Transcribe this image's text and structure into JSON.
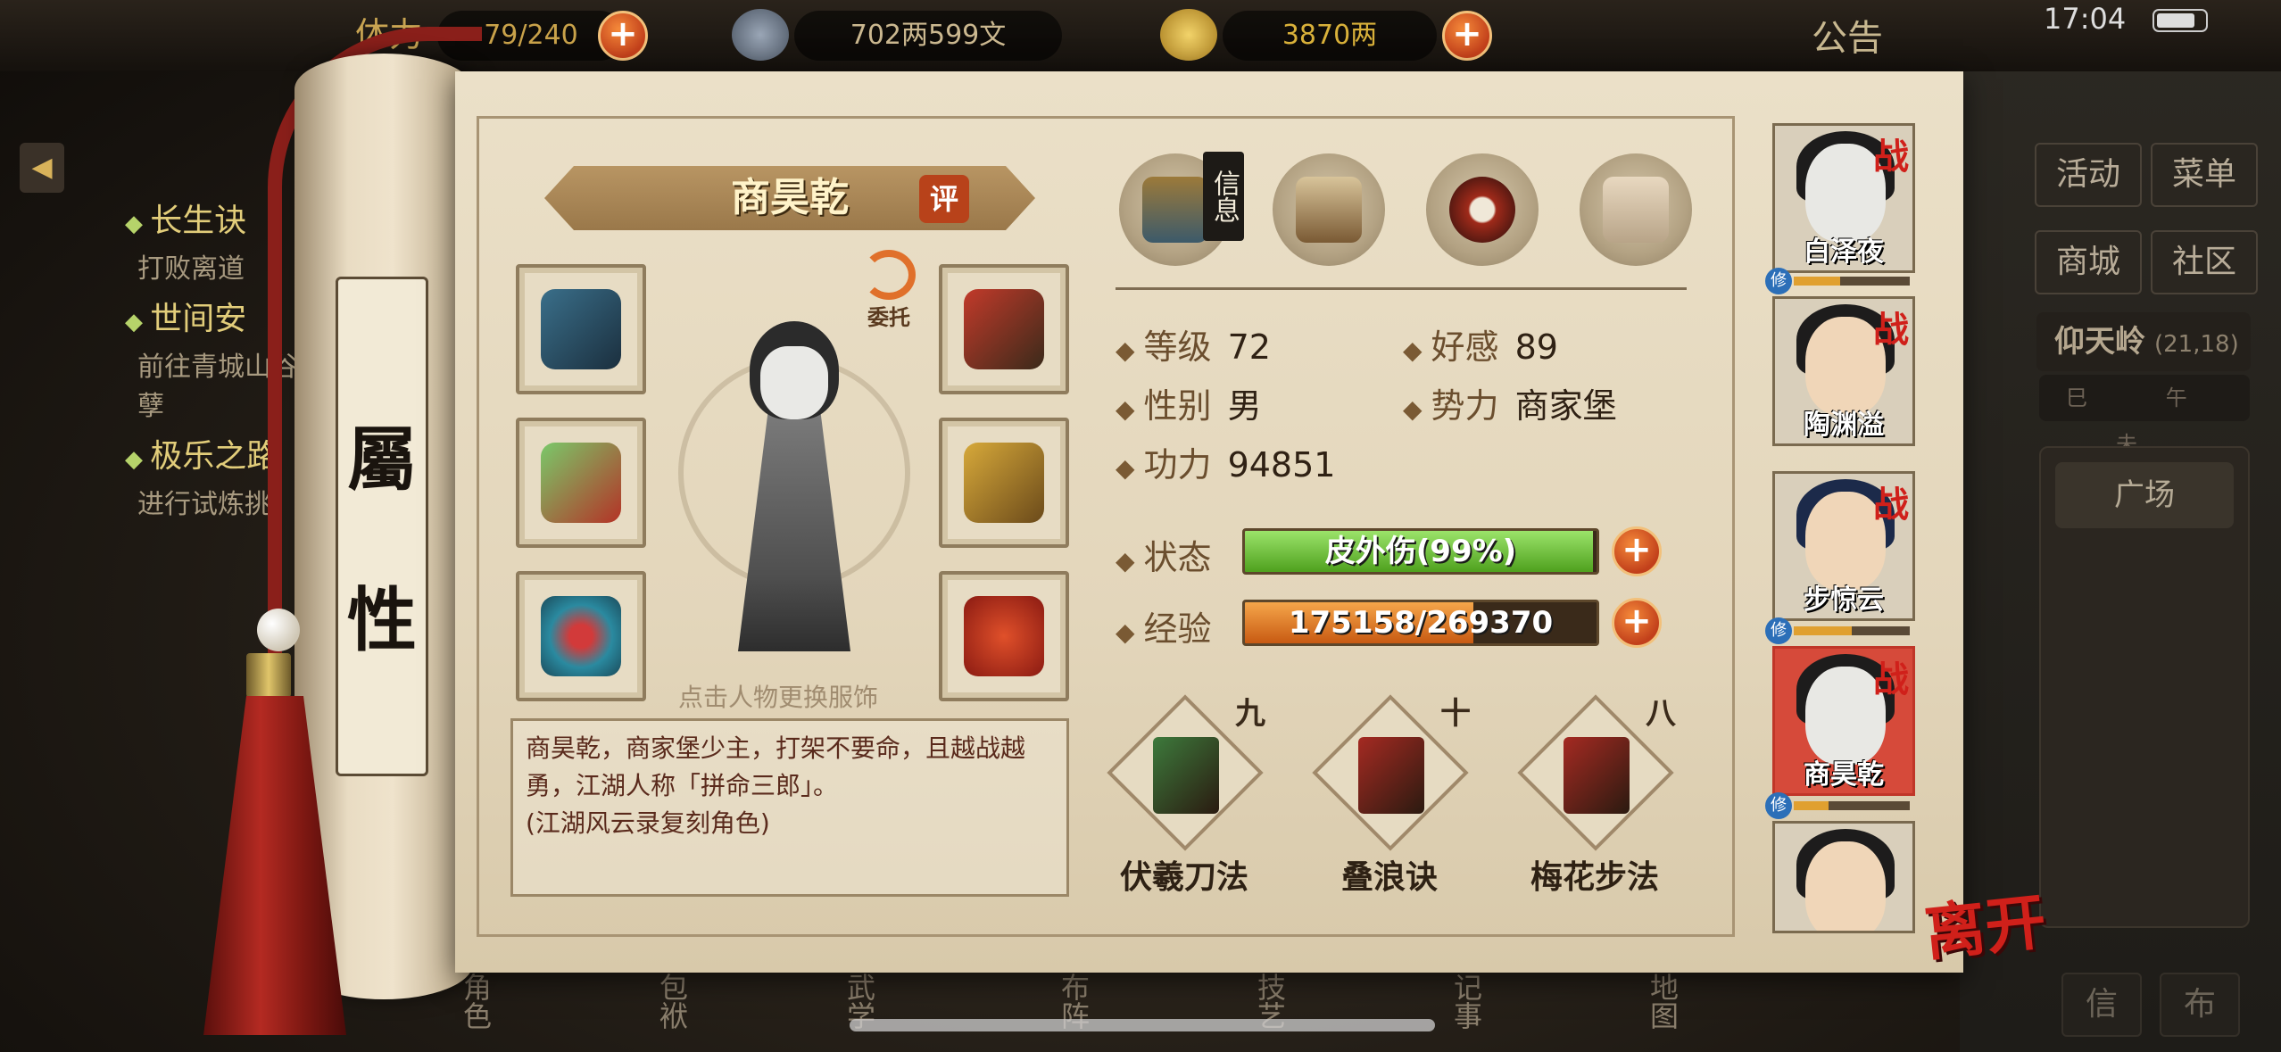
{
  "topbar": {
    "stamina_label": "体力",
    "stamina": "79/240",
    "silver": "702两599文",
    "gold": "3870两",
    "notice": "公告",
    "time": "17:04"
  },
  "quests": [
    {
      "title": "长生诀",
      "desc": "打败离道"
    },
    {
      "title": "世间安",
      "desc": "前往青城山谷落逃余孽"
    },
    {
      "title": "极乐之路",
      "desc": "进行试炼挑"
    }
  ],
  "side_menu": {
    "activity": "活动",
    "menu": "菜单",
    "shop": "商城",
    "community": "社区",
    "location_name": "仰天岭",
    "location_coords": "(21,18)",
    "compass": "巳 午 未",
    "plaza": "广场",
    "small_btn_1": "信",
    "small_btn_2": "布"
  },
  "scroll": {
    "label_top": "屬",
    "label_bottom": "性"
  },
  "character": {
    "name": "商昊乾",
    "rate": "评",
    "delegate": "委托",
    "change_hint": "点击人物更换服饰",
    "description": "商昊乾，商家堡少主，打架不要命，且越战越勇，江湖人称「拼命三郎」。",
    "description_note": "(江湖风云录复刻角色)"
  },
  "tabs": {
    "info_label": "信息"
  },
  "stats": {
    "level_label": "等级",
    "level": "72",
    "favor_label": "好感",
    "favor": "89",
    "gender_label": "性别",
    "gender": "男",
    "faction_label": "势力",
    "faction": "商家堡",
    "power_label": "功力",
    "power": "94851",
    "status_label": "状态",
    "status": "皮外伤(99%)",
    "status_fraction": 0.99,
    "exp_label": "经验",
    "exp": "175158/269370",
    "exp_fraction": 0.65
  },
  "skills": [
    {
      "name": "伏羲刀法",
      "level": "九",
      "color": "#3d7a3c"
    },
    {
      "name": "叠浪诀",
      "level": "十",
      "color": "#a52a22"
    },
    {
      "name": "梅花步法",
      "level": "八",
      "color": "#a52a22"
    }
  ],
  "roster": [
    {
      "name": "白泽夜",
      "battle": "战",
      "cult": "修"
    },
    {
      "name": "陶渊溢",
      "battle": "战"
    },
    {
      "name": "步惊云",
      "battle": "战",
      "cult": "修"
    },
    {
      "name": "商昊乾",
      "battle": "战",
      "cult": "修"
    },
    {
      "name": ""
    }
  ],
  "leave": "离开",
  "bottom_nav": [
    "角色",
    "包袱",
    "武学",
    "布阵",
    "技艺",
    "记事",
    "地图"
  ],
  "colors": {
    "status_bar": "#6fc23a",
    "exp_bar": "#e07a1e",
    "accent_red": "#d0201a"
  }
}
